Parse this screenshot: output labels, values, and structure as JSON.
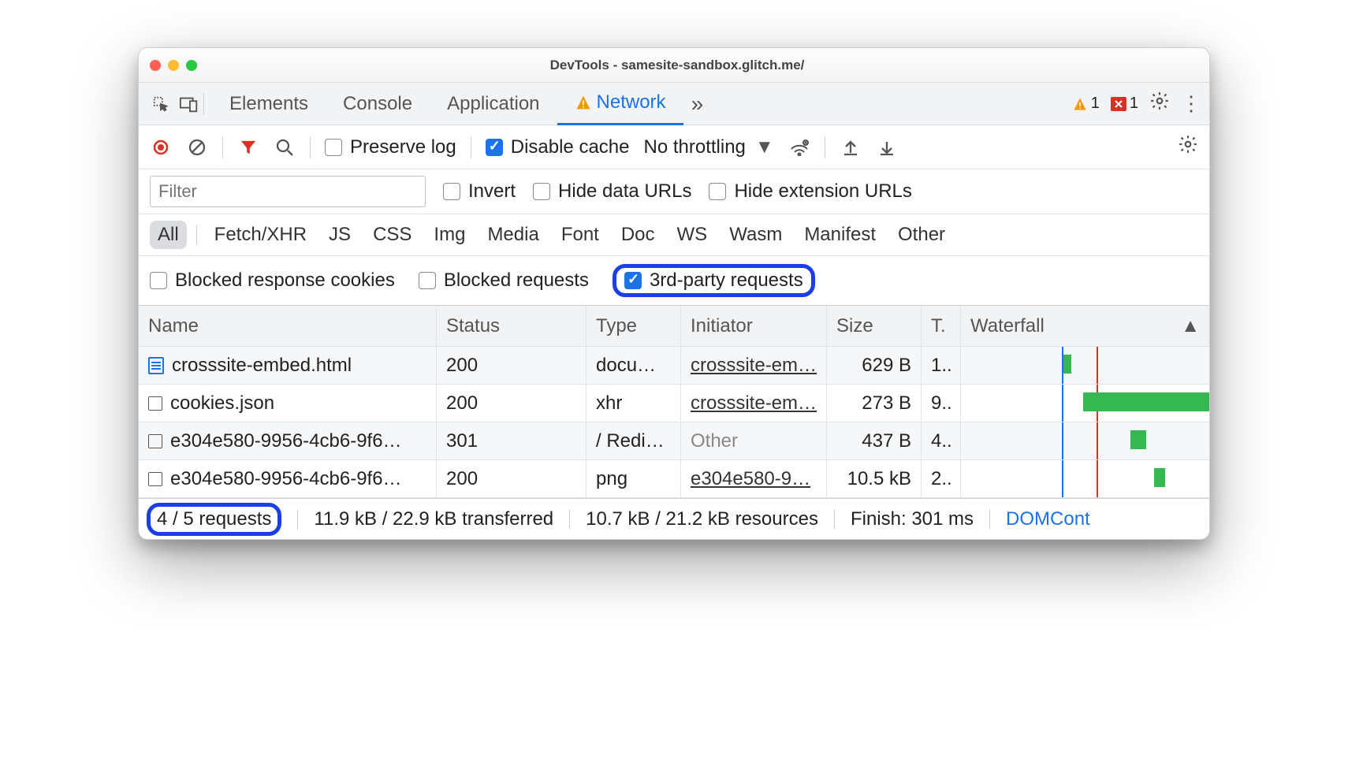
{
  "window_title": "DevTools - samesite-sandbox.glitch.me/",
  "tabs": {
    "t0": "Elements",
    "t1": "Console",
    "t2": "Application",
    "t3": "Network"
  },
  "badges": {
    "warn": "1",
    "err": "1"
  },
  "toolbar": {
    "preserve": "Preserve log",
    "disable": "Disable cache",
    "throttle": "No throttling"
  },
  "filter": {
    "placeholder": "Filter",
    "invert": "Invert",
    "hdr": "Hide data URLs",
    "hext": "Hide extension URLs"
  },
  "cats": {
    "all": "All",
    "xhr": "Fetch/XHR",
    "js": "JS",
    "css": "CSS",
    "img": "Img",
    "media": "Media",
    "font": "Font",
    "doc": "Doc",
    "ws": "WS",
    "wasm": "Wasm",
    "mani": "Manifest",
    "other": "Other"
  },
  "blocked": {
    "brc": "Blocked response cookies",
    "br": "Blocked requests",
    "tpr": "3rd-party requests"
  },
  "headers": {
    "name": "Name",
    "status": "Status",
    "type": "Type",
    "init": "Initiator",
    "size": "Size",
    "time": "T.",
    "wf": "Waterfall"
  },
  "rows": [
    {
      "name": "crosssite-embed.html",
      "status": "200",
      "type": "docu…",
      "init": "crosssite-em…",
      "itype": "link",
      "size": "629 B",
      "time": "1..",
      "doc": true
    },
    {
      "name": "cookies.json",
      "status": "200",
      "type": "xhr",
      "init": "crosssite-em…",
      "itype": "link",
      "size": "273 B",
      "time": "9..",
      "doc": false
    },
    {
      "name": "e304e580-9956-4cb6-9f6…",
      "status": "301",
      "type": "/ Redi…",
      "init": "Other",
      "itype": "other",
      "size": "437 B",
      "time": "4..",
      "doc": false
    },
    {
      "name": "e304e580-9956-4cb6-9f6…",
      "status": "200",
      "type": "png",
      "init": "e304e580-9…",
      "itype": "link",
      "size": "10.5 kB",
      "time": "2..",
      "doc": false
    }
  ],
  "status": {
    "reqs": "4 / 5 requests",
    "trans": "11.9 kB / 22.9 kB transferred",
    "res": "10.7 kB / 21.2 kB resources",
    "fin": "Finish: 301 ms",
    "dom": "DOMCont"
  }
}
